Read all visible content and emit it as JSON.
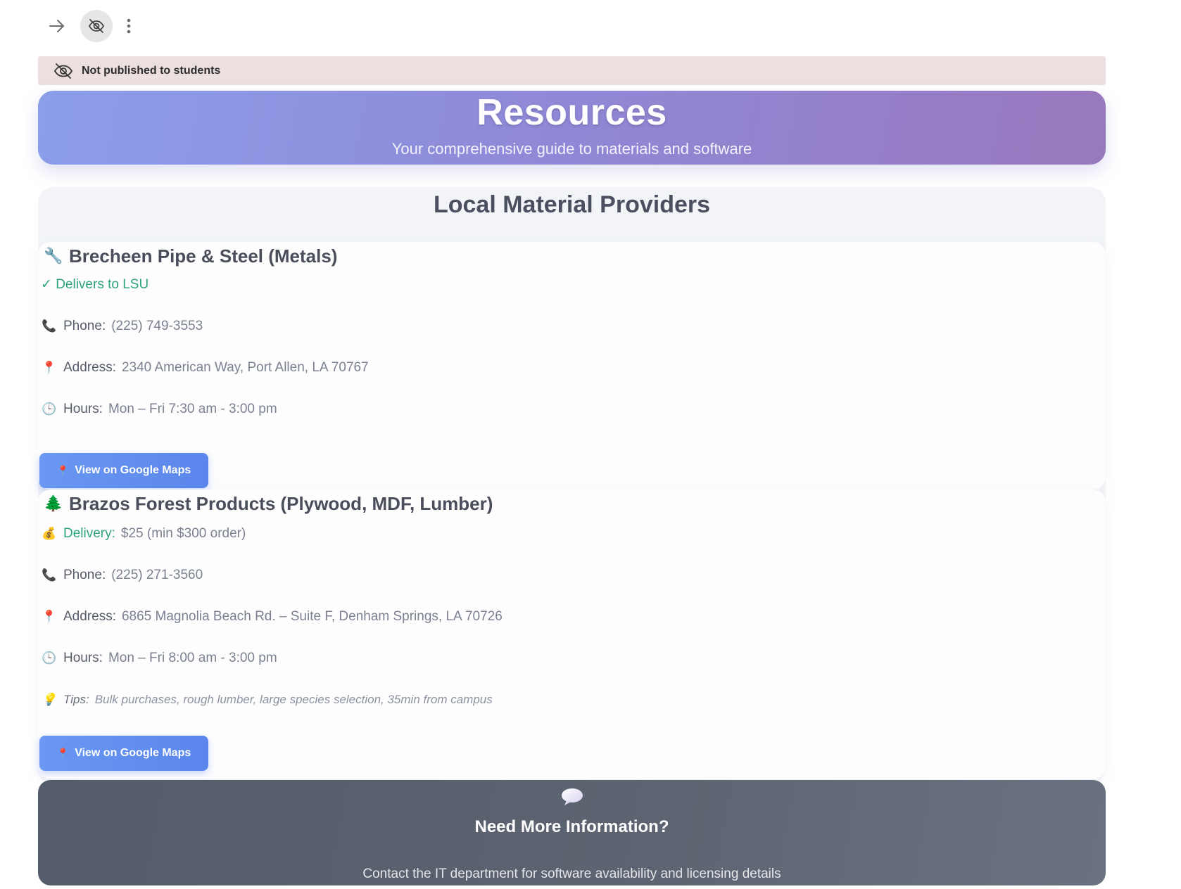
{
  "toolbar": {
    "forward_icon": "arrow-right-icon",
    "visibility_icon": "eye-slash-icon",
    "more_icon": "more-vertical-icon"
  },
  "banner": {
    "icon": "eye-slash-icon",
    "text": "Not published to students"
  },
  "hero": {
    "title": "Resources",
    "subtitle": "Your comprehensive guide to materials and software"
  },
  "providers": {
    "title": "Local Material Providers",
    "items": [
      {
        "emoji": "🔧",
        "name": "Brecheen Pipe & Steel (Metals)",
        "delivery_line": "✓ Delivers to LSU",
        "phone_label": "Phone:",
        "phone": "(225) 749-3553",
        "address_label": "Address:",
        "address": "2340 American Way, Port Allen, LA 70767",
        "hours_label": "Hours:",
        "hours": "Mon – Fri 7:30 am - 3:00 pm",
        "button_label": "View on Google Maps"
      },
      {
        "emoji": "🌲",
        "name": "Brazos Forest Products (Plywood, MDF, Lumber)",
        "delivery_label": "Delivery:",
        "delivery": "$25 (min $300 order)",
        "phone_label": "Phone:",
        "phone": "(225) 271-3560",
        "address_label": "Address:",
        "address": "6865 Magnolia Beach Rd. – Suite F, Denham Springs, LA 70726",
        "hours_label": "Hours:",
        "hours": "Mon – Fri 8:00 am - 3:00 pm",
        "tips_label": "Tips:",
        "tips": "Bulk purchases, rough lumber, large species selection, 35min from campus",
        "button_label": "View on Google Maps"
      }
    ]
  },
  "contact": {
    "icon": "speech-bubble-icon",
    "title": "Need More Information?",
    "text": "Contact the IT department for software availability and licensing details"
  },
  "colors": {
    "banner_bg": "#ecdfdf",
    "hero_start": "#8b9ee9",
    "hero_end": "#9878bd",
    "accent_green": "#2fa37a",
    "button_blue": "#5b86ec",
    "footer_bg": "#5a616e"
  }
}
